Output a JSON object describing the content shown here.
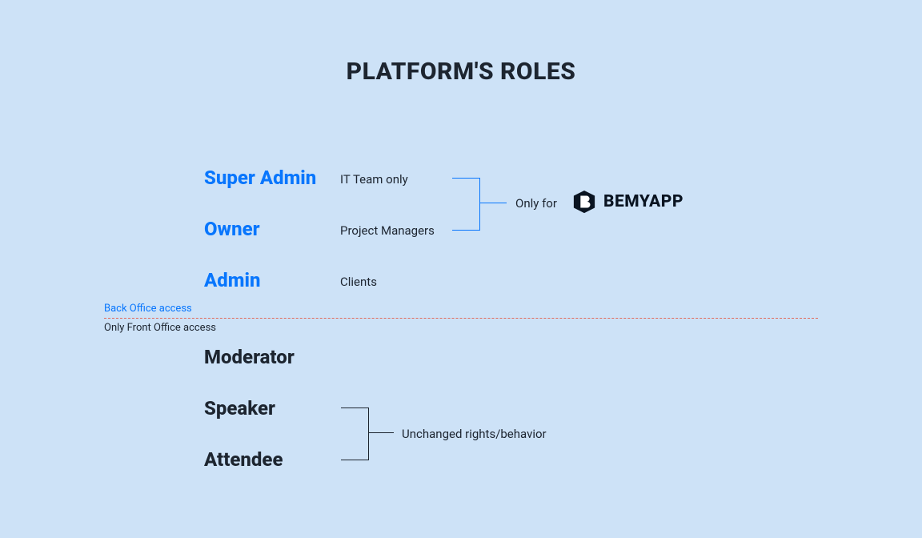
{
  "title": "PLATFORM'S ROLES",
  "roles": {
    "superAdmin": {
      "label": "Super Admin",
      "desc": "IT Team only"
    },
    "owner": {
      "label": "Owner",
      "desc": "Project Managers"
    },
    "admin": {
      "label": "Admin",
      "desc": "Clients"
    },
    "moderator": {
      "label": "Moderator"
    },
    "speaker": {
      "label": "Speaker"
    },
    "attendee": {
      "label": "Attendee"
    }
  },
  "onlyFor": {
    "prefix": "Only for",
    "brand": "BEMYAPP"
  },
  "divider": {
    "back": "Back Office access",
    "front": "Only Front Office access"
  },
  "unchanged": "Unchanged rights/behavior",
  "colors": {
    "accent": "#0876fd",
    "bg": "#cde2f7",
    "divider": "#e06a5a",
    "text": "#1d2530"
  }
}
